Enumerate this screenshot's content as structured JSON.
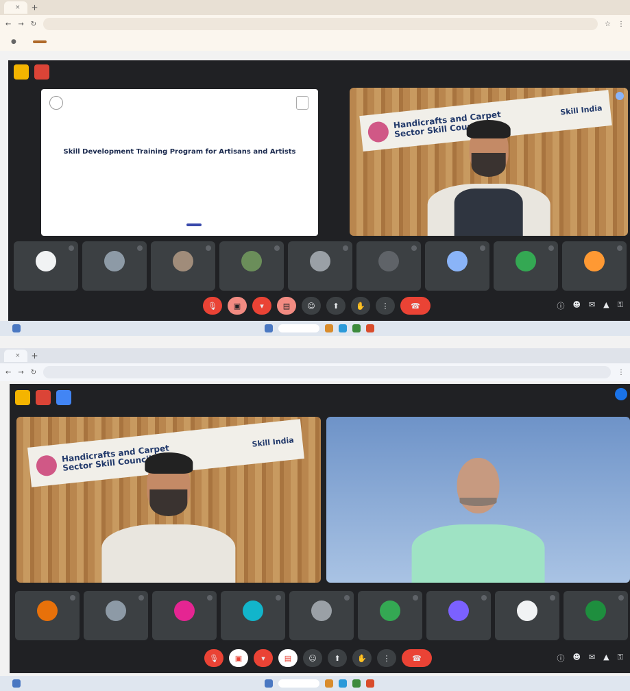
{
  "screenshot_top": {
    "tab_label": "",
    "url": "",
    "meeting_title": "",
    "slide": {
      "logo_center": "",
      "heading": "Skill Development Training Program for Artisans and Artists"
    },
    "speaker_banner": {
      "line1": "Handicrafts and Carpet",
      "line2": "Sector Skill Council",
      "brand": "Skill India"
    },
    "speaker_name": "",
    "participants": [
      {
        "name": "",
        "color": "#f1f3f4"
      },
      {
        "name": "",
        "color": "#8d9aa6"
      },
      {
        "name": "",
        "color": "#a08c7a"
      },
      {
        "name": "",
        "color": "#6b8e5a"
      },
      {
        "name": "",
        "color": "#9aa0a6"
      },
      {
        "name": "",
        "color": "#5f6368"
      },
      {
        "name": "",
        "color": "#8ab4f8"
      },
      {
        "name": "",
        "color": "#34a853"
      },
      {
        "name": "",
        "color": "#ff9933"
      }
    ],
    "meet_code": ""
  },
  "screenshot_bottom": {
    "url": "",
    "speaker_banner": {
      "line1": "Handicrafts and Carpet",
      "line2": "Sector Skill Council",
      "brand": "Skill India"
    },
    "left_tile_name": "",
    "right_tile_name": "",
    "participants": [
      {
        "name": "",
        "color": "#e8710a"
      },
      {
        "name": "",
        "color": "#8d9aa6"
      },
      {
        "name": "",
        "color": "#e52592"
      },
      {
        "name": "",
        "color": "#12b5cb"
      },
      {
        "name": "",
        "color": "#9aa0a6"
      },
      {
        "name": "",
        "color": "#34a853"
      },
      {
        "name": "",
        "color": "#7b61ff"
      },
      {
        "name": "",
        "color": "#f1f3f4"
      },
      {
        "name": "",
        "color": "#1e8e3e"
      }
    ],
    "meet_code": ""
  },
  "icons": {
    "reload": "reload-icon",
    "mic": "mic-icon",
    "camera": "camera-icon",
    "end_call": "end-call-icon",
    "people": "people-icon",
    "chat": "chat-icon"
  },
  "colors": {
    "meet_bg": "#202124",
    "tile_bg": "#3c4043",
    "end_call": "#ea4335"
  }
}
